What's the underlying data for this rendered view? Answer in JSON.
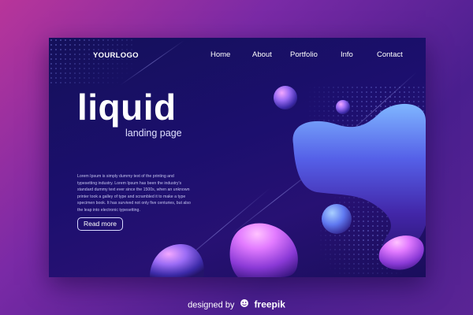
{
  "header": {
    "logo": "YOURLOGO",
    "nav": [
      {
        "label": "Home"
      },
      {
        "label": "About"
      },
      {
        "label": "Portfolio"
      },
      {
        "label": "Info"
      },
      {
        "label": "Contact"
      }
    ]
  },
  "hero": {
    "title": "liquid",
    "subtitle": "landing page",
    "body": "Lorem Ipsum is simply dummy text of the printing and typesetting industry. Lorem Ipsum has been the industry's standard dummy text ever since the 1500s, when an unknown printer took a galley of type and scrambled it to make a type specimen book. It has survived not only five centuries, but also the leap into electronic typesetting.",
    "button_label": "Read more"
  },
  "footer": {
    "prefix": "designed by",
    "brand": "freepik",
    "brand_icon": "freepik-face-icon"
  },
  "colors": {
    "background_pink": "#b8359a",
    "background_purple": "#4a1f8f",
    "panel_navy": "#14105a",
    "blob_blue": "#4f8cff",
    "blob_pink": "#f07bff"
  }
}
